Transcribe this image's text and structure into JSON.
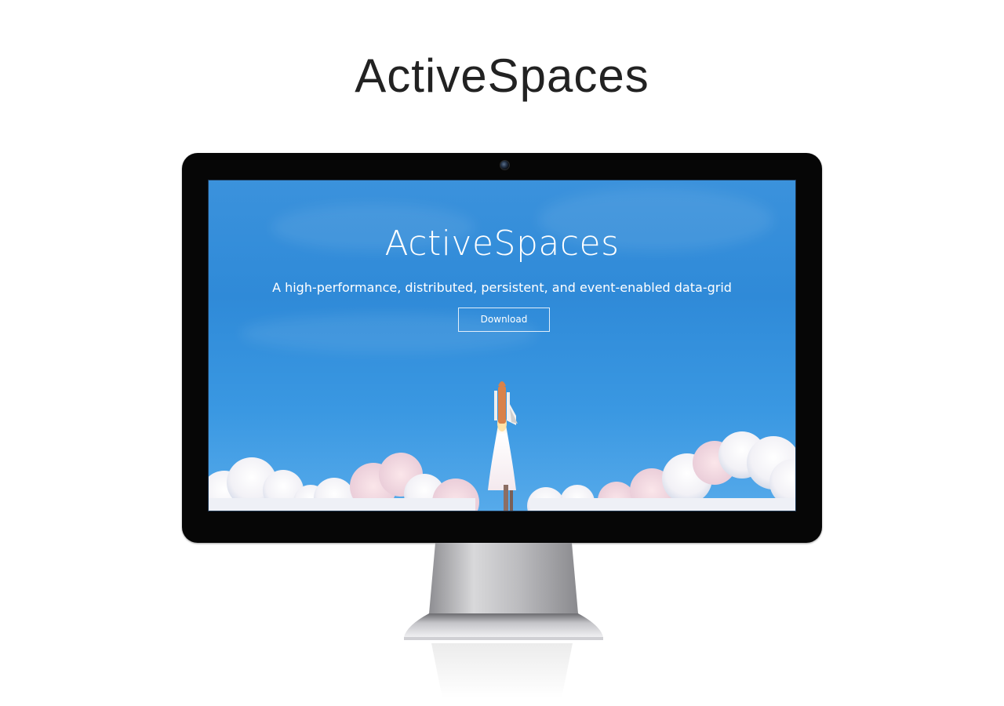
{
  "page": {
    "title": "ActiveSpaces"
  },
  "screen": {
    "hero_title": "ActiveSpaces",
    "tagline": "A high-performance, distributed, persistent, and event-enabled data-grid",
    "download_label": "Download",
    "background_image": "rocket-launch-over-clouds"
  },
  "monitor": {
    "camera_icon": "webcam-icon",
    "stand": "aluminum-monitor-stand"
  },
  "colors": {
    "sky": "#3390da",
    "bezel": "#060606",
    "title_text": "#222222"
  }
}
